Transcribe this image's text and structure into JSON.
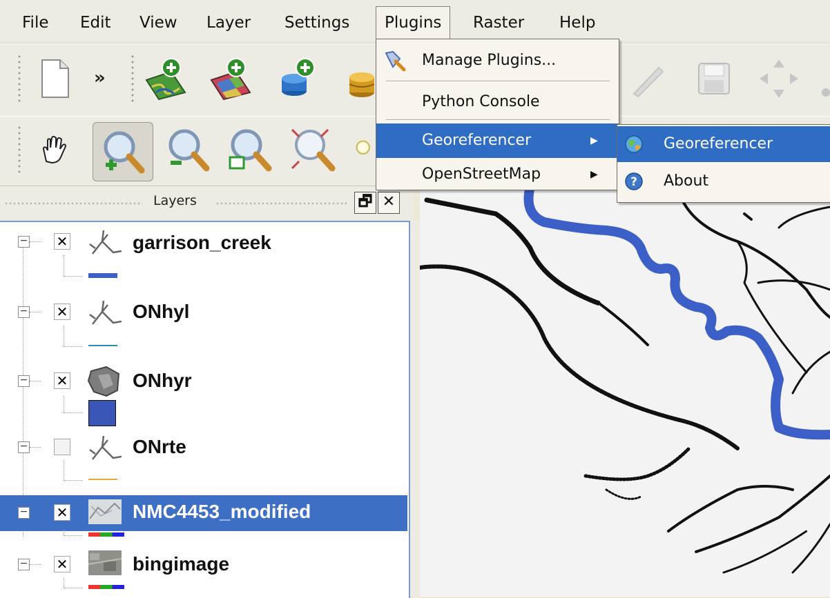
{
  "menubar": {
    "items": [
      "File",
      "Edit",
      "View",
      "Layer",
      "Settings",
      "Plugins",
      "Raster",
      "Help"
    ],
    "open_menu": "Plugins"
  },
  "plugins_menu": {
    "items": [
      {
        "label": "Manage Plugins...",
        "icon": "plug-icon",
        "submenu": false
      },
      {
        "label": "Python Console",
        "icon": "",
        "submenu": false
      },
      {
        "label": "Georeferencer",
        "icon": "",
        "submenu": true,
        "highlighted": true
      },
      {
        "label": "OpenStreetMap",
        "icon": "",
        "submenu": true
      }
    ]
  },
  "georeferencer_submenu": {
    "items": [
      {
        "label": "Georeferencer",
        "icon": "georeferencer-globe-icon",
        "highlighted": true
      },
      {
        "label": "About",
        "icon": "help-about-icon"
      }
    ]
  },
  "toolbar_1": {
    "buttons": [
      "new-project-icon",
      "more-chevron-icon",
      "add-vector-layer-icon",
      "add-raster-layer-icon",
      "add-postgis-layer-icon",
      "add-spatialite-layer-icon",
      "toggle-editing-icon",
      "save-edits-icon",
      "move-feature-icon"
    ],
    "overflow_label": "»"
  },
  "toolbar_2": {
    "buttons": [
      "pan-icon",
      "zoom-in-icon",
      "zoom-out-icon",
      "zoom-native-icon",
      "zoom-full-icon"
    ]
  },
  "layers_panel": {
    "title": "Layers",
    "float_label": "🗗",
    "close_label": "✕",
    "layers": [
      {
        "name": "garrison_creek",
        "visible": true,
        "type": "line",
        "color": "#3b5fc6"
      },
      {
        "name": "ONhyl",
        "visible": true,
        "type": "line",
        "color": "#2c8fa6"
      },
      {
        "name": "ONhyr",
        "visible": true,
        "type": "polygon",
        "color": "#3a57b8"
      },
      {
        "name": "ONrte",
        "visible": false,
        "type": "line",
        "color": "#e8a83a"
      },
      {
        "name": "NMC4453_modified",
        "visible": true,
        "type": "raster",
        "selected": true
      },
      {
        "name": "bingimage",
        "visible": true,
        "type": "raster"
      }
    ]
  },
  "colors": {
    "menu_highlight": "#2f6cc4",
    "creek_line": "#3b5fc6",
    "selection": "#3d6fc4"
  }
}
